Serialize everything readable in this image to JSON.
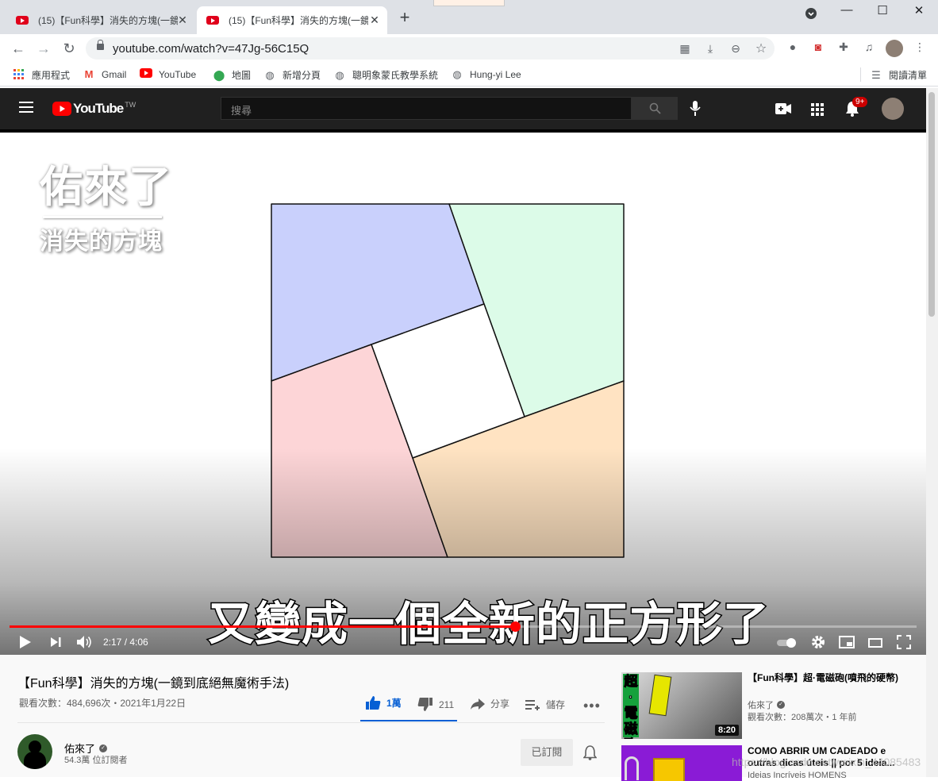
{
  "browser": {
    "tabs": [
      {
        "title": "(15)【Fun科學】消失的方塊(一鏡到底絕無魔術手法) - YouTube",
        "active": false
      },
      {
        "title": "(15)【Fun科學】消失的方塊(一鏡到底絕無魔術手法) - YouTube",
        "active": true
      }
    ],
    "url": "youtube.com/watch?v=47Jg-56C15Q",
    "bookmarks": [
      "應用程式",
      "Gmail",
      "YouTube",
      "地圖",
      "新增分頁",
      "聰明象蒙氏教學系統",
      "Hung-yi Lee"
    ],
    "reading_list": "閱讀清單"
  },
  "youtube": {
    "logo_text": "YouTube",
    "region": "TW",
    "search_placeholder": "搜尋",
    "notifications": "9+",
    "player": {
      "channel_mark_line1": "佑來了",
      "channel_mark_line2": "消失的方塊",
      "subtitle": "又變成一個全新的正方形了",
      "time": "2:17 / 4:06",
      "progress": 0.557
    },
    "video": {
      "title": "【Fun科學】消失的方塊(一鏡到底絕無魔術手法)",
      "meta": "觀看次數：484,696次・2021年1月22日",
      "likes": "1萬",
      "dislikes": "211",
      "share": "分享",
      "save": "儲存",
      "channel": "佑來了",
      "subscribers": "54.3萬 位訂閱者",
      "subscribed": "已訂閱"
    },
    "related": [
      {
        "title": "【Fun科學】超·電磁砲(噴飛的硬幣)",
        "channel": "佑來了",
        "meta": "觀看次數：208萬次・1 年前",
        "duration": "8:20",
        "thumb_text": "超·電磁砲"
      },
      {
        "title": "COMO ABRIR UM CADEADO e outras dicas úteis || por 5 ideia...",
        "channel": "Ideias Incríveis HOMENS"
      }
    ],
    "watermark": "https://blog.csdn.net/weixin_44085483"
  },
  "colors": {
    "piece_blue": "#c9d0fc",
    "piece_green": "#dcfbe8",
    "piece_pink": "#fdd5d7",
    "piece_orange": "#ffe3c2",
    "yt_red": "#ff0000",
    "yt_blue": "#065fd4"
  }
}
